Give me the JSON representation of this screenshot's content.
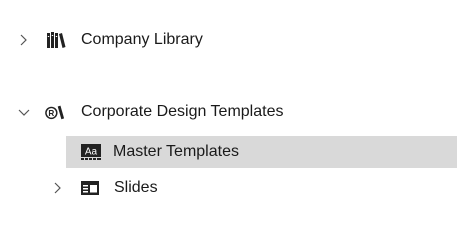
{
  "tree": {
    "items": [
      {
        "label": "Company Library",
        "icon": "books-icon",
        "expanded": false
      },
      {
        "label": "Corporate Design Templates",
        "icon": "registered-library-icon",
        "expanded": true
      },
      {
        "label": "Master Templates",
        "icon": "master-template-icon",
        "selected": true
      },
      {
        "label": "Slides",
        "icon": "slides-icon",
        "expanded": false
      }
    ]
  },
  "colors": {
    "selection": "#d9d9d9",
    "chevron": "#555555"
  }
}
